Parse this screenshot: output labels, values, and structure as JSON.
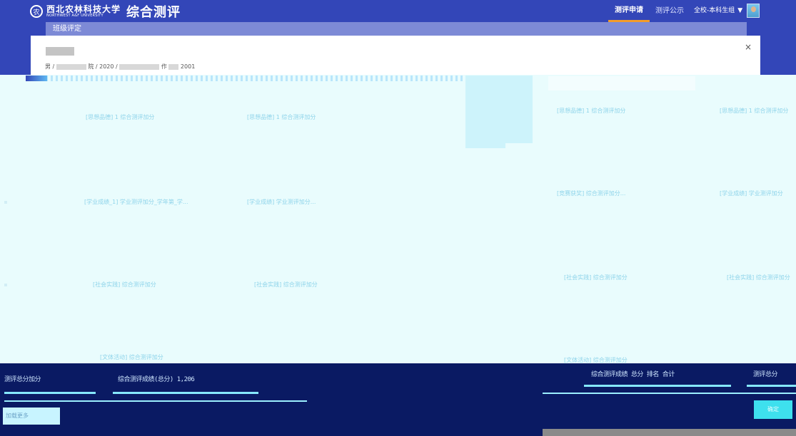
{
  "header": {
    "logo_seal_text": "农",
    "logo_cn": "西北农林科技大学",
    "logo_en": "NORTHWEST A&F UNIVERSITY",
    "app_title": "综合测评",
    "nav": [
      "测评申请",
      "测评公示"
    ],
    "role": "全校-本科生组",
    "role_caret": "▼",
    "avatar_icon": "user-avatar",
    "accent_color": "#3346b8",
    "active_tab_underline": "#f39c2a"
  },
  "breadcrumb": "班级评定",
  "student": {
    "path_prefix": "男 /",
    "path_seg2": "院 / 2020 /",
    "path_seg3": "作",
    "path_tail": "2001"
  },
  "close_icon": "×",
  "items": [
    "[思想品德] 1 综合测评加分",
    "[思想品德] 1 综合测评加分",
    "[思想品德] 1 综合测评加分",
    "[思想品德] 1 综合测评加分",
    "[学业成绩_1] 学业测评加分_学年第_学...",
    "[学业成绩] 学业测评加分...",
    "[竞赛获奖] 综合测评加分...",
    "[学业成绩] 学业测评加分",
    "[社会实践] 综合测评加分",
    "[社会实践] 综合测评加分",
    "[社会实践] 综合测评加分",
    "[社会实践] 综合测评加分",
    "[文体活动] 综合测评加分",
    "[文体活动] 综合测评加分"
  ],
  "bottom": {
    "label_a": "测评总分加分",
    "label_b": "综合测评成绩(总分) 1,206",
    "label_c": "综合测评成绩 总分 排名 合计",
    "label_d": "测评总分",
    "load_more": "加载更多",
    "confirm": "确定"
  }
}
